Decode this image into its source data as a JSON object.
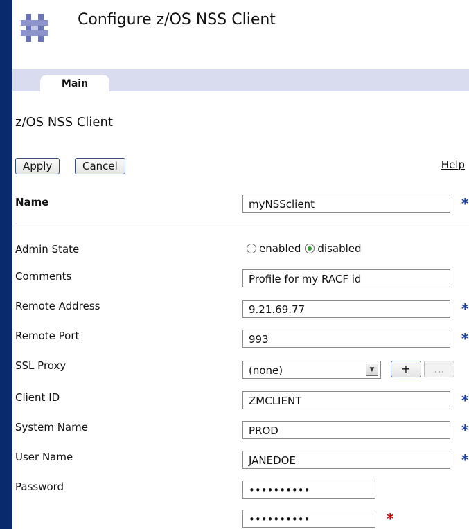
{
  "page": {
    "title": "Configure z/OS NSS Client"
  },
  "tabs": [
    {
      "label": "Main"
    }
  ],
  "section": {
    "title": "z/OS NSS Client"
  },
  "actions": {
    "apply": "Apply",
    "cancel": "Cancel",
    "help": "Help"
  },
  "required_marker": "*",
  "fields": {
    "name": {
      "label": "Name",
      "value": "myNSSclient"
    },
    "admin_state": {
      "label": "Admin State",
      "options": [
        "enabled",
        "disabled"
      ],
      "selected": "disabled"
    },
    "comments": {
      "label": "Comments",
      "value": "Profile for my RACF id"
    },
    "remote_address": {
      "label": "Remote Address",
      "value": "9.21.69.77"
    },
    "remote_port": {
      "label": "Remote Port",
      "value": "993"
    },
    "ssl_proxy": {
      "label": "SSL Proxy",
      "value": "(none)",
      "add_label": "+",
      "edit_label": "..."
    },
    "client_id": {
      "label": "Client ID",
      "value": "ZMCLIENT"
    },
    "system_name": {
      "label": "System Name",
      "value": "PROD"
    },
    "user_name": {
      "label": "User Name",
      "value": "JANEDOE"
    },
    "password": {
      "label": "Password",
      "value": "••••••••••",
      "confirm_value": "••••••••••"
    }
  },
  "colors": {
    "required_blue": "#1a3faa",
    "required_red": "#cc0000",
    "tab_bar": "#d9dcef",
    "selected_radio": "#2aa02a"
  }
}
